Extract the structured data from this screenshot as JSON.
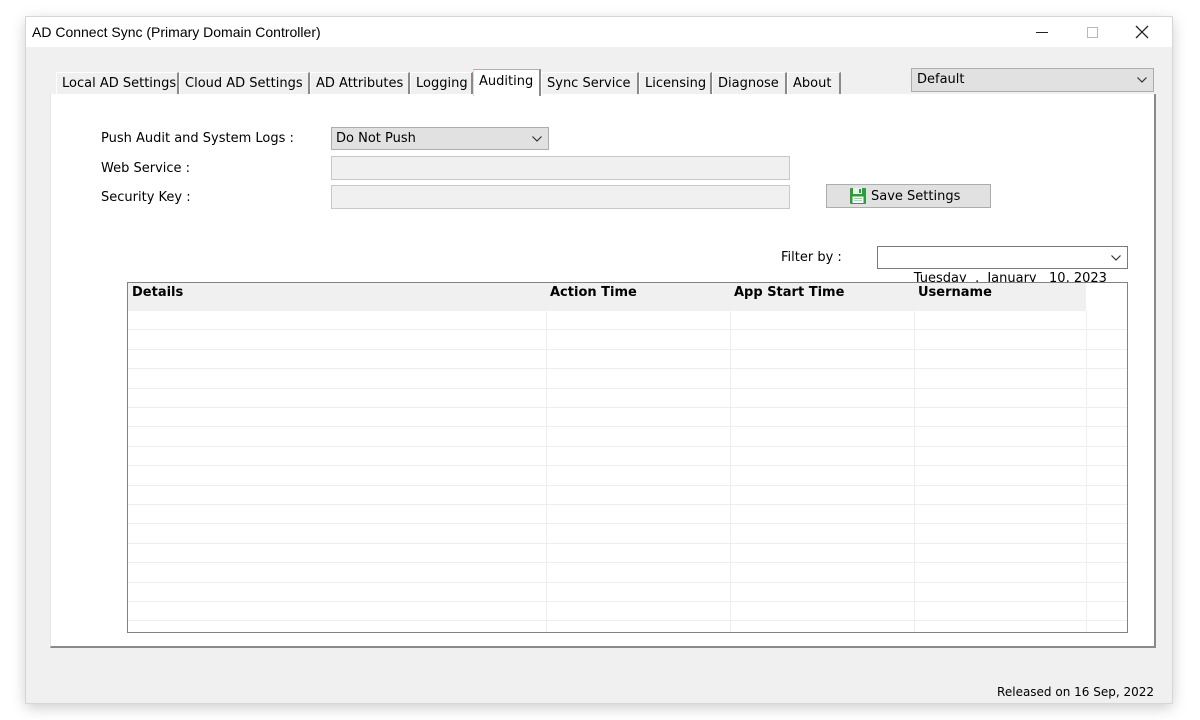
{
  "window": {
    "title": "AD Connect Sync (Primary Domain Controller)"
  },
  "tabs": [
    {
      "label": "Local AD Settings"
    },
    {
      "label": "Cloud AD Settings"
    },
    {
      "label": "AD Attributes"
    },
    {
      "label": "Logging"
    },
    {
      "label": "Auditing",
      "active": true
    },
    {
      "label": "Sync Service"
    },
    {
      "label": "Licensing"
    },
    {
      "label": "Diagnose"
    },
    {
      "label": "About"
    }
  ],
  "profile_select": {
    "value": "Default"
  },
  "form": {
    "push_label": "Push Audit and System Logs :",
    "push_value": "Do Not Push",
    "web_service_label": "Web Service :",
    "web_service_value": "",
    "security_key_label": "Security Key :",
    "security_key_value": "",
    "save_label": "Save Settings"
  },
  "filter": {
    "label": "Filter by :",
    "date": "Tuesday  ,  January   10, 2023"
  },
  "grid": {
    "columns": [
      "Details",
      "Action Time",
      "App Start Time",
      "Username"
    ],
    "rows": []
  },
  "footer": {
    "released": "Released on 16 Sep, 2022"
  },
  "colors": {
    "active_tab_accent": "#f5a623",
    "save_icon": "#2e9b3f"
  }
}
